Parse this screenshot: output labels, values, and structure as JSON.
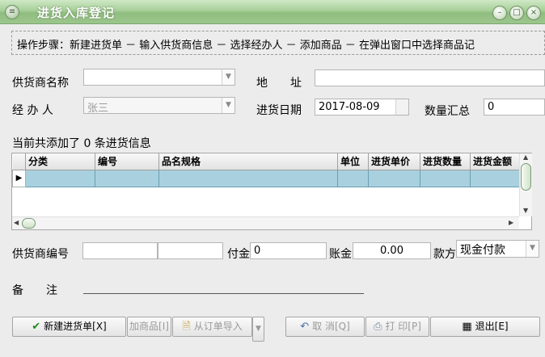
{
  "window": {
    "title": "进货入库登记"
  },
  "steps_text": "操作步骤：新建进货单 － 输入供货商信息 － 选择经办人 － 添加商品 － 在弹出窗口中选择商品记",
  "form": {
    "supplier_name_label": "供货商名称",
    "supplier_name_value": "",
    "address_label": "地　　址",
    "address_value": "",
    "handler_label": "经 办 人",
    "handler_value": "张三",
    "date_label": "进货日期",
    "date_value": "2017-08-09",
    "qty_total_label": "数量汇总",
    "qty_total_value": "0"
  },
  "grid": {
    "count_text": "当前共添加了 0 条进货信息",
    "columns": [
      "分类",
      "编号",
      "品名规格",
      "单位",
      "进货单价",
      "进货数量",
      "进货金额"
    ]
  },
  "bottom": {
    "supplier_code_label": "供货商编号",
    "supplier_code_value": "",
    "supplier_code_value2": "",
    "paid_label": "付金",
    "paid_value": "0",
    "account_label": "账金",
    "account_value": "0.00",
    "payment_label": "款方",
    "payment_value": "现金付款",
    "remark_label": "备　　注"
  },
  "buttons": {
    "new_order": "新建进货单[X]",
    "add_goods": "加商品[I]",
    "import_order": "从订单导入",
    "cancel": "取 消[Q]",
    "print": "打 印[P]",
    "exit": "退出[E]"
  },
  "colors": {
    "titlebar": "#9cc68d",
    "selected_row": "#a8d0de",
    "background": "#ececec"
  }
}
